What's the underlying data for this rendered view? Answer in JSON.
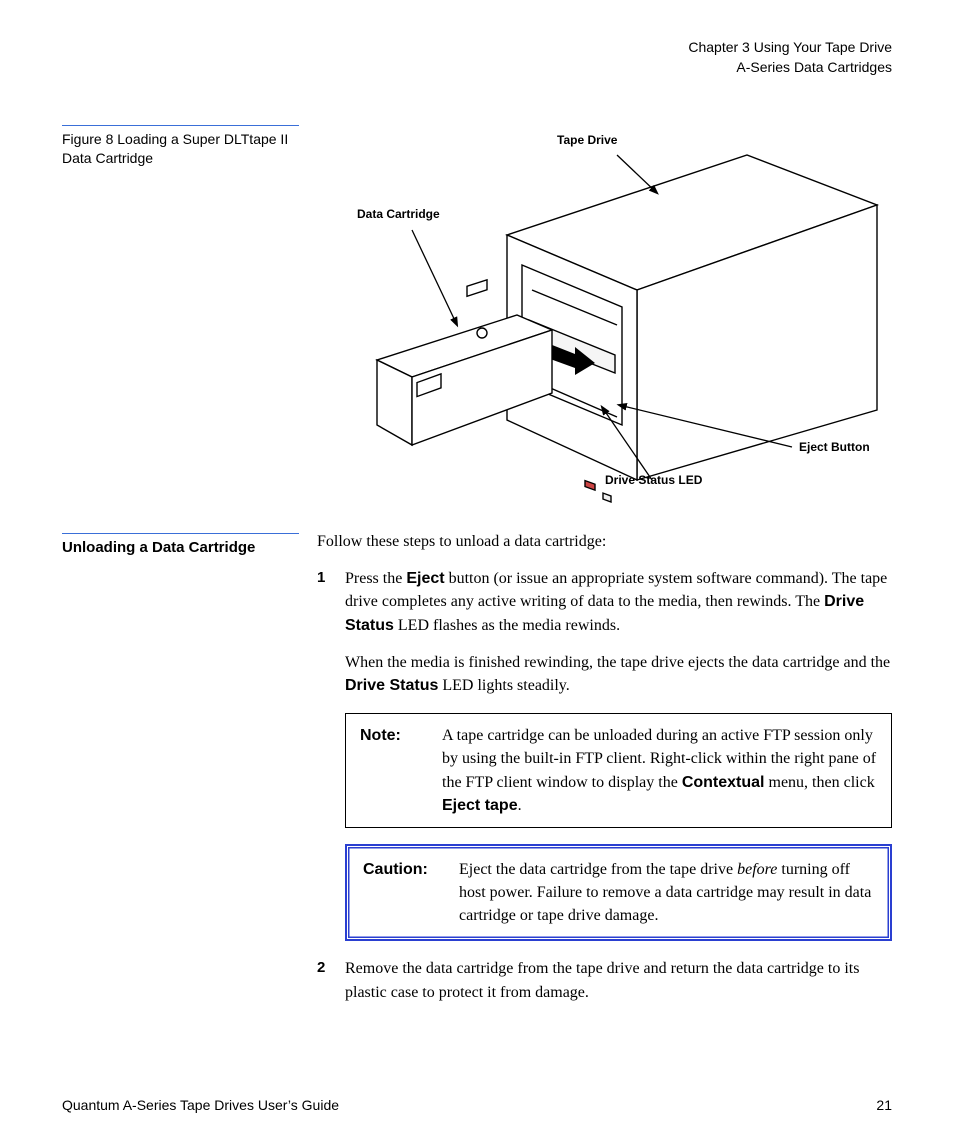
{
  "header": {
    "chapter": "Chapter 3  Using Your Tape Drive",
    "section": "A-Series Data Cartridges"
  },
  "figure": {
    "caption": "Figure 8  Loading a Super DLTtape II Data Cartridge",
    "labels": {
      "tape_drive": "Tape Drive",
      "data_cartridge": "Data Cartridge",
      "eject_button": "Eject Button",
      "drive_status_led": "Drive Status LED"
    }
  },
  "section2": {
    "heading": "Unloading a Data Cartridge",
    "intro": "Follow these steps to unload a data cartridge:",
    "step1_a": "Press the ",
    "step1_b": "Eject",
    "step1_c": " button (or issue an appropriate system software command). The tape drive completes any active writing of data to the media, then rewinds. The ",
    "step1_d": "Drive Status",
    "step1_e": " LED flashes as the media rewinds.",
    "step1_p2a": "When the media is finished rewinding, the tape drive ejects the data cartridge and the ",
    "step1_p2b": "Drive Status",
    "step1_p2c": " LED lights steadily.",
    "note_tag": "Note:",
    "note_a": "A tape cartridge can be unloaded during an active FTP session only by using the built-in FTP client. Right-click within the right pane of the FTP client window to display the ",
    "note_b": "Contextual",
    "note_c": " menu, then click ",
    "note_d": "Eject tape",
    "note_e": ".",
    "caution_tag": "Caution:",
    "caution_a": "Eject the data cartridge from the tape drive ",
    "caution_b": "before",
    "caution_c": " turning off host power. Failure to remove a data cartridge may result in data cartridge or tape drive damage.",
    "step2": "Remove the data cartridge from the tape drive and return the data cartridge to its plastic case to protect it from damage."
  },
  "footer": {
    "left": "Quantum A-Series Tape Drives User’s Guide",
    "right": "21"
  }
}
